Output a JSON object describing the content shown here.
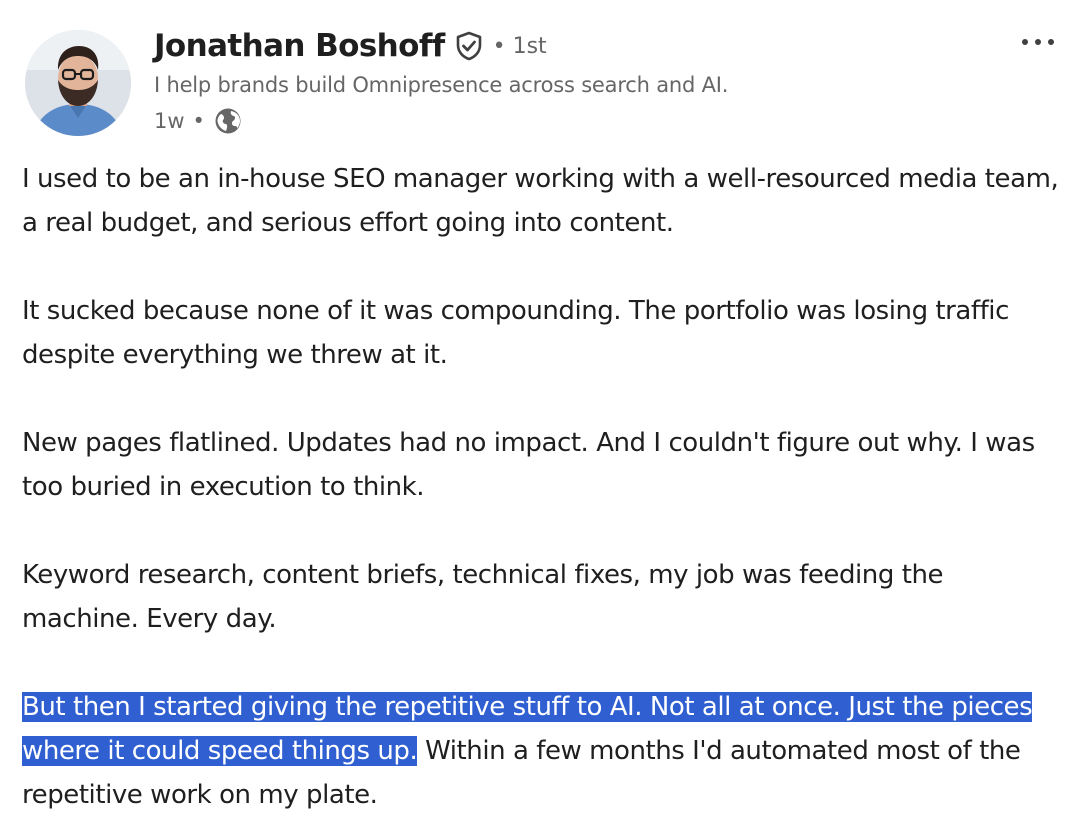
{
  "author": {
    "name": "Jonathan Boshoff",
    "verified_icon": "verified-shield-icon",
    "degree_separator": "•",
    "degree": "1st",
    "headline": "I help brands build Omnipresence across search and AI.",
    "time_ago": "1w",
    "meta_separator": "•",
    "visibility_icon": "globe-icon"
  },
  "menu": {
    "more_icon": "ellipsis-icon"
  },
  "post": {
    "paragraphs": [
      "I used to be an in-house SEO manager working with a well-resourced media team, a real budget, and serious effort going into content.",
      "It sucked because none of it was compounding. The portfolio was losing traffic despite everything we threw at it.",
      "New pages flatlined. Updates had no impact. And I couldn't figure out why. I was too buried in execution to think.",
      "Keyword research, content briefs, technical fixes, my job was feeding the machine. Every day."
    ],
    "last_paragraph": {
      "selected_text": "But then I started giving the repetitive stuff to AI. Not all at once. Just the pieces where it could speed things up.",
      "rest_text": " Within a few months I'd automated most of the repetitive work on my plate."
    }
  },
  "colors": {
    "text": "#1f1f1f",
    "secondary_text": "#666666",
    "selection_background": "#2f5fd0",
    "selection_text": "#ffffff"
  }
}
